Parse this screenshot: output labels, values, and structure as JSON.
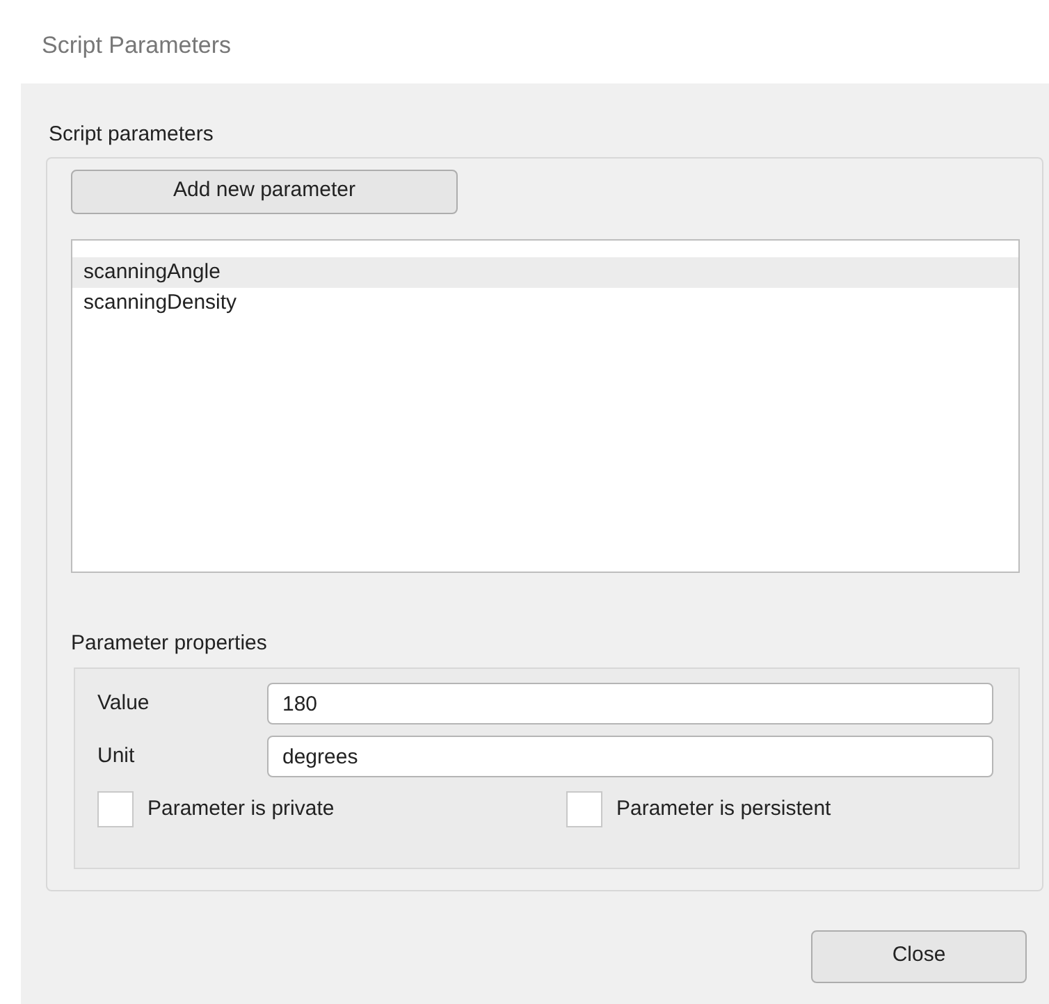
{
  "window": {
    "title": "Script Parameters"
  },
  "parameters_group": {
    "label": "Script parameters",
    "add_button": "Add new parameter",
    "items": [
      {
        "label": "scanningAngle",
        "selected": true
      },
      {
        "label": "scanningDensity",
        "selected": false
      }
    ]
  },
  "properties_group": {
    "label": "Parameter properties",
    "fields": [
      {
        "label": "Value",
        "value": "180"
      },
      {
        "label": "Unit",
        "value": "degrees"
      }
    ],
    "checkboxes": [
      {
        "label": "Parameter is private",
        "checked": false
      },
      {
        "label": "Parameter is persistent",
        "checked": false
      }
    ]
  },
  "buttons": [
    "Close"
  ]
}
